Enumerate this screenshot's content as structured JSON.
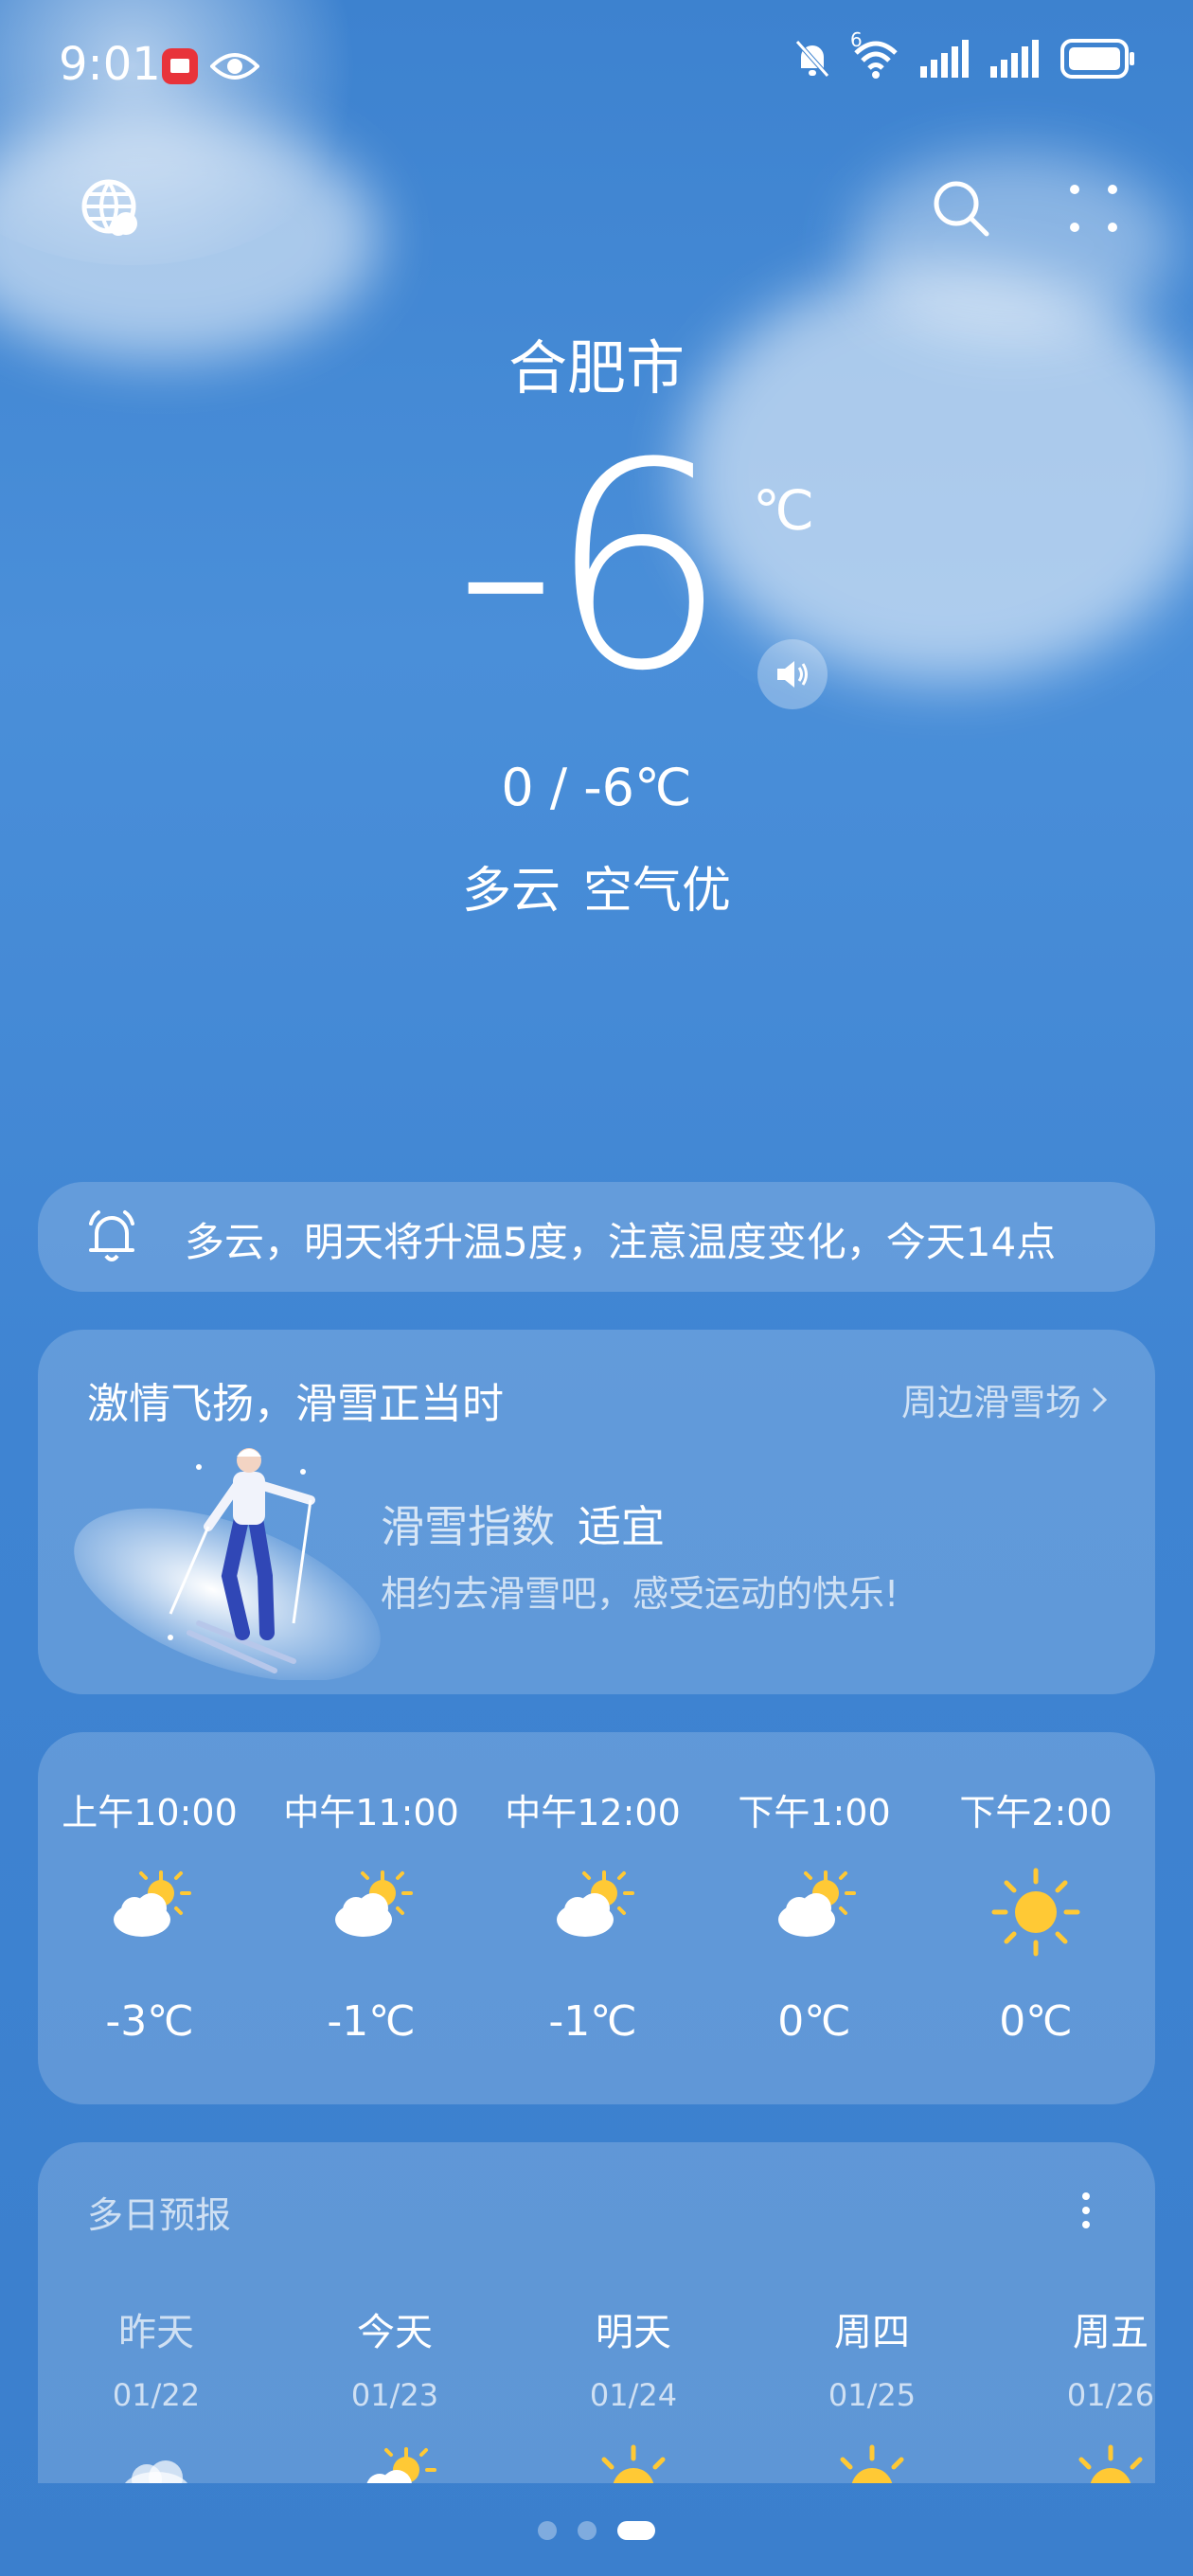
{
  "status": {
    "time": "9:01",
    "network_label": "6"
  },
  "location": {
    "city": "合肥市"
  },
  "current": {
    "temp": "-6",
    "unit": "℃",
    "range": "0 / -6℃",
    "condition": "多云",
    "air": "空气优"
  },
  "alert": {
    "text": "多云，明天将升温5度，注意温度变化，今天14点"
  },
  "ski": {
    "title": "激情飞扬，滑雪正当时",
    "link": "周边滑雪场",
    "index_label": "滑雪指数",
    "index_value": "适宜",
    "desc": "相约去滑雪吧，感受运动的快乐!"
  },
  "hourly": [
    {
      "time": "上午10:00",
      "icon": "partly-sunny-icon",
      "temp": "-3℃"
    },
    {
      "time": "中午11:00",
      "icon": "partly-sunny-icon",
      "temp": "-1℃"
    },
    {
      "time": "中午12:00",
      "icon": "partly-sunny-icon",
      "temp": "-1℃"
    },
    {
      "time": "下午1:00",
      "icon": "partly-sunny-icon",
      "temp": "0℃"
    },
    {
      "time": "下午2:00",
      "icon": "sun-icon",
      "temp": "0℃"
    }
  ],
  "forecast": {
    "title": "多日预报",
    "days": [
      {
        "name": "昨天",
        "date": "01/22",
        "icon": "cloud-icon"
      },
      {
        "name": "今天",
        "date": "01/23",
        "icon": "partly-sunny-icon"
      },
      {
        "name": "明天",
        "date": "01/24",
        "icon": "sun-icon"
      },
      {
        "name": "周四",
        "date": "01/25",
        "icon": "sun-icon"
      },
      {
        "name": "周五",
        "date": "01/26",
        "icon": "sun-icon"
      }
    ]
  },
  "pages": {
    "count": 3,
    "active": 3
  },
  "colors": {
    "sky": "#3f86d4",
    "sun": "#ffc935"
  }
}
